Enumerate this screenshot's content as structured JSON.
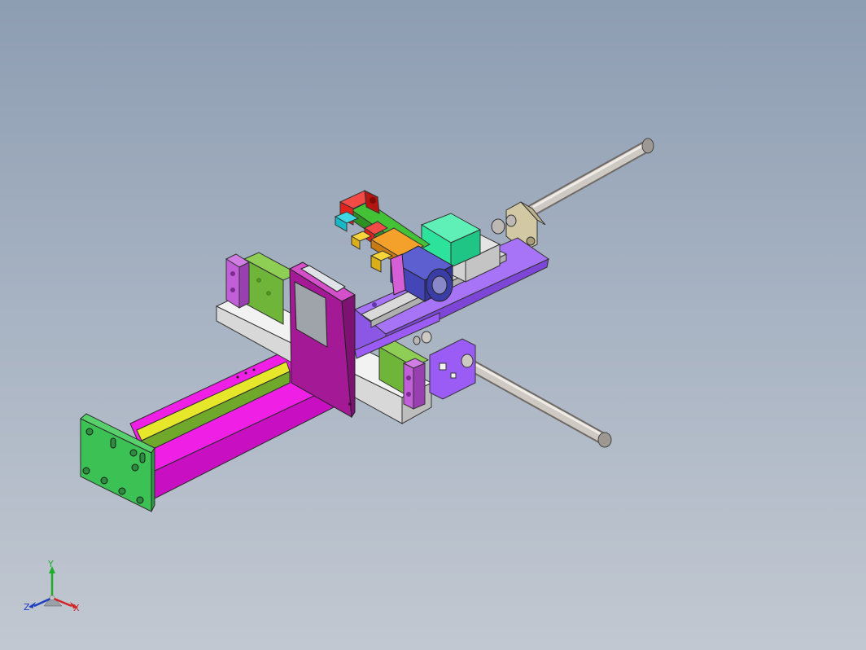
{
  "triad": {
    "x_label": "X",
    "y_label": "Y",
    "z_label": "Z"
  },
  "colors": {
    "background_top": "#8d9db2",
    "background_bottom": "#c2c8d1",
    "magenta_beam": "#ee1ee3",
    "green_block": "#3cc155",
    "purple_plate": "#9b5cf5",
    "white_plate": "#eeeeee",
    "lime_block": "#6fb53a",
    "violet_bracket": "#c15fd8",
    "yellow_rail": "#e6e62a",
    "mint_block": "#2de39b",
    "navy_cylinder": "#4446b7",
    "rod_grey": "#c9c3bd",
    "red_part": "#e1211b",
    "cyan_part": "#16b8c8"
  }
}
